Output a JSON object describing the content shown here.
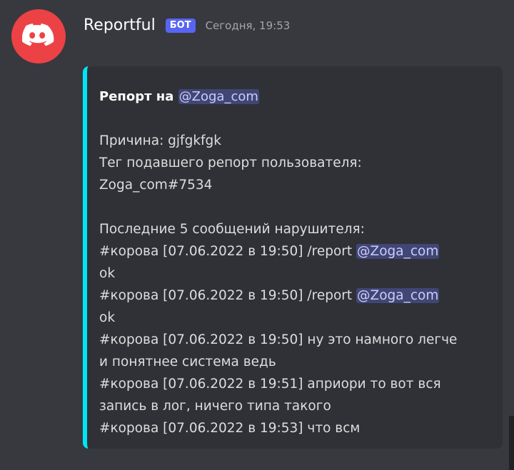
{
  "author": {
    "username": "Reportful",
    "badge": "БОТ",
    "timestamp": "Сегодня, 19:53",
    "avatar_icon": "discord-logo-icon",
    "avatar_color": "#ed4245"
  },
  "embed": {
    "accent_color": "#00e5f5",
    "title_prefix": "Репорт на",
    "title_mention": "@Zoga_com",
    "reason": "Причина: gjfgkfgk",
    "tag_label": "Тег подавшего репорт пользователя:",
    "tag_value": "Zoga_com#7534",
    "messages_header": "Последние 5 сообщений нарушителя:",
    "messages": [
      {
        "line1_prefix": "#корова [07.06.2022 в 19:50] /report",
        "mention": "@Zoga_com",
        "line2": "ok"
      },
      {
        "line1_prefix": "#корова [07.06.2022 в 19:50] /report",
        "mention": "@Zoga_com",
        "line2": "ok"
      },
      {
        "line1": "#корова [07.06.2022 в 19:50] ну это намного легче",
        "line2": "и понятнее система ведь"
      },
      {
        "line1": "#корова [07.06.2022 в 19:51] априори то вот вся",
        "line2": "запись в лог, ничего типа такого"
      },
      {
        "line1": "#корова [07.06.2022 в 19:53] что всм"
      }
    ]
  }
}
